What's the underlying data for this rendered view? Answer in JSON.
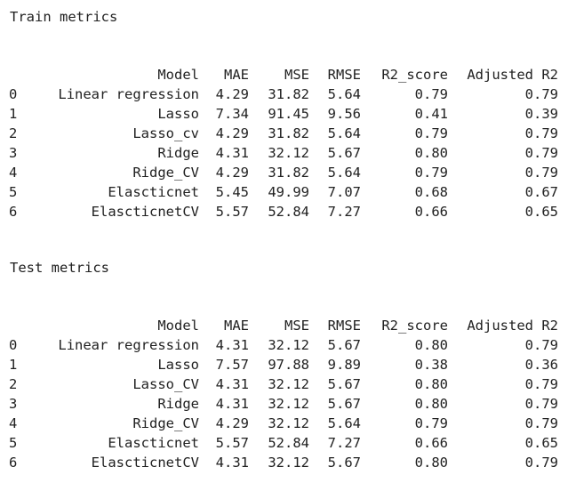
{
  "train": {
    "title": "Train metrics",
    "columns": [
      "Model",
      "MAE",
      "MSE",
      "RMSE",
      "R2_score",
      "Adjusted R2"
    ],
    "rows": [
      {
        "index": "0",
        "model": "Linear regression",
        "mae": "4.29",
        "mse": "31.82",
        "rmse": "5.64",
        "r2": "0.79",
        "adj": "0.79"
      },
      {
        "index": "1",
        "model": "Lasso",
        "mae": "7.34",
        "mse": "91.45",
        "rmse": "9.56",
        "r2": "0.41",
        "adj": "0.39"
      },
      {
        "index": "2",
        "model": "Lasso_cv",
        "mae": "4.29",
        "mse": "31.82",
        "rmse": "5.64",
        "r2": "0.79",
        "adj": "0.79"
      },
      {
        "index": "3",
        "model": "Ridge",
        "mae": "4.31",
        "mse": "32.12",
        "rmse": "5.67",
        "r2": "0.80",
        "adj": "0.79"
      },
      {
        "index": "4",
        "model": "Ridge_CV",
        "mae": "4.29",
        "mse": "31.82",
        "rmse": "5.64",
        "r2": "0.79",
        "adj": "0.79"
      },
      {
        "index": "5",
        "model": "Elascticnet",
        "mae": "5.45",
        "mse": "49.99",
        "rmse": "7.07",
        "r2": "0.68",
        "adj": "0.67"
      },
      {
        "index": "6",
        "model": "ElascticnetCV",
        "mae": "5.57",
        "mse": "52.84",
        "rmse": "7.27",
        "r2": "0.66",
        "adj": "0.65"
      }
    ]
  },
  "test": {
    "title": "Test metrics",
    "columns": [
      "Model",
      "MAE",
      "MSE",
      "RMSE",
      "R2_score",
      "Adjusted R2"
    ],
    "rows": [
      {
        "index": "0",
        "model": "Linear regression",
        "mae": "4.31",
        "mse": "32.12",
        "rmse": "5.67",
        "r2": "0.80",
        "adj": "0.79"
      },
      {
        "index": "1",
        "model": "Lasso",
        "mae": "7.57",
        "mse": "97.88",
        "rmse": "9.89",
        "r2": "0.38",
        "adj": "0.36"
      },
      {
        "index": "2",
        "model": "Lasso_CV",
        "mae": "4.31",
        "mse": "32.12",
        "rmse": "5.67",
        "r2": "0.80",
        "adj": "0.79"
      },
      {
        "index": "3",
        "model": "Ridge",
        "mae": "4.31",
        "mse": "32.12",
        "rmse": "5.67",
        "r2": "0.80",
        "adj": "0.79"
      },
      {
        "index": "4",
        "model": "Ridge_CV",
        "mae": "4.29",
        "mse": "32.12",
        "rmse": "5.64",
        "r2": "0.79",
        "adj": "0.79"
      },
      {
        "index": "5",
        "model": "Elascticnet",
        "mae": "5.57",
        "mse": "52.84",
        "rmse": "7.27",
        "r2": "0.66",
        "adj": "0.65"
      },
      {
        "index": "6",
        "model": "ElascticnetCV",
        "mae": "4.31",
        "mse": "32.12",
        "rmse": "5.67",
        "r2": "0.80",
        "adj": "0.79"
      }
    ]
  }
}
